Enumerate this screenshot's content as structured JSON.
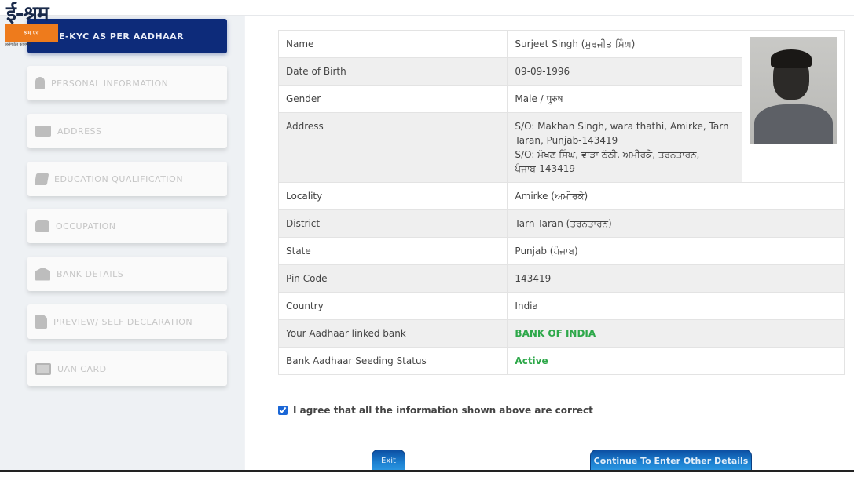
{
  "logo": {
    "title": "ई-श्रम",
    "band_text": "श्रम एव",
    "subtitle": "असंगठित कामगार"
  },
  "sidebar": {
    "items": [
      {
        "label": "E-KYC AS PER AADHAAR",
        "icon": "fingerprint-icon",
        "active": true
      },
      {
        "label": "PERSONAL INFORMATION",
        "icon": "user-icon",
        "active": false
      },
      {
        "label": "ADDRESS",
        "icon": "address-card-icon",
        "active": false
      },
      {
        "label": "EDUCATION QUALIFICATION",
        "icon": "book-icon",
        "active": false
      },
      {
        "label": "OCCUPATION",
        "icon": "briefcase-icon",
        "active": false
      },
      {
        "label": "BANK DETAILS",
        "icon": "bank-icon",
        "active": false
      },
      {
        "label": "PREVIEW/ SELF DECLARATION",
        "icon": "document-icon",
        "active": false
      },
      {
        "label": "UAN CARD",
        "icon": "id-card-icon",
        "active": false
      }
    ]
  },
  "details": {
    "rows": [
      {
        "label": "Name",
        "value": "Surjeet Singh (ਸੁਰਜੀਤ ਸਿੰਘ)"
      },
      {
        "label": "Date of Birth",
        "value": "09-09-1996"
      },
      {
        "label": "Gender",
        "value": "Male / पुरुष"
      },
      {
        "label": "Address",
        "value": "S/O: Makhan Singh, wara thathi, Amirke, Tarn Taran, Punjab-143419",
        "value2": "S/O: ਮੱਖਣ ਸਿੰਘ, ਵਾੜਾ ਠੱਠੀ, ਅਮੀਰਕੇ, ਤਰਨਤਾਰਨ, ਪੰਜਾਬ-143419"
      },
      {
        "label": "Locality",
        "value": "Amirke (ਅਮੀਰਕੇ)"
      },
      {
        "label": "District",
        "value": "Tarn Taran (ਤਰਨਤਾਰਨ)"
      },
      {
        "label": "State",
        "value": "Punjab (ਪੰਜਾਬ)"
      },
      {
        "label": "Pin Code",
        "value": "143419"
      },
      {
        "label": "Country",
        "value": "India"
      },
      {
        "label": "Your Aadhaar linked bank",
        "value": "BANK OF INDIA"
      },
      {
        "label": "Bank Aadhaar Seeding Status",
        "value": "Active"
      }
    ],
    "status_color": "#2ea84a"
  },
  "agreement": {
    "checked": true,
    "label": "I agree that all the information shown above are correct"
  },
  "buttons": {
    "exit": "Exit",
    "continue": "Continue To Enter Other Details"
  }
}
